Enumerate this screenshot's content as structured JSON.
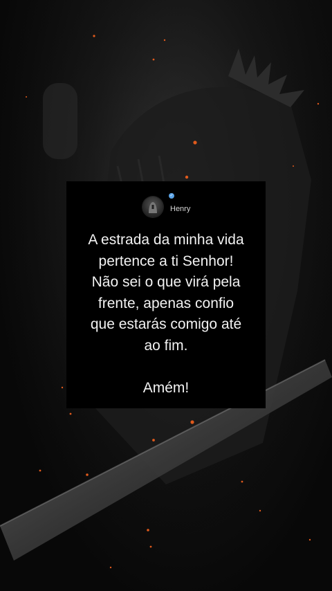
{
  "post": {
    "author": {
      "name": "Henry",
      "verified_icon": "verified-badge-icon",
      "avatar_icon": "avatar-knight-icon"
    },
    "message_lines": [
      "A estrada da minha vida",
      "pertence a ti Senhor!",
      "Não sei o que virá pela",
      "frente, apenas confio",
      "que estarás comigo até",
      "ao fim."
    ],
    "closing": "Amém!"
  },
  "colors": {
    "background": "#0b0b0b",
    "card": "#000000",
    "text": "#f2f2f2",
    "ember": "#e05a1c",
    "verified": "#5aa3e6"
  }
}
